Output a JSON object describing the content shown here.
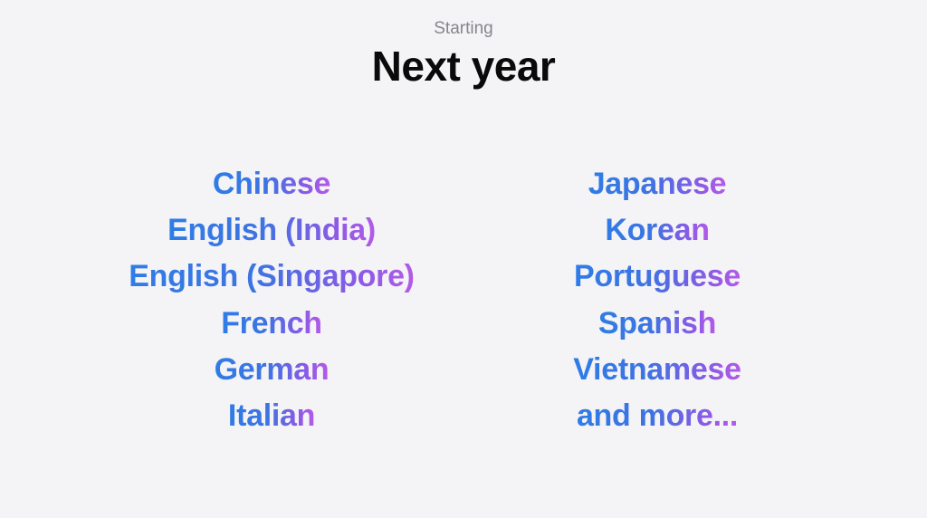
{
  "header": {
    "kicker": "Starting",
    "title": "Next year"
  },
  "languages": {
    "left": [
      "Chinese",
      "English (India)",
      "English (Singapore)",
      "French",
      "German",
      "Italian"
    ],
    "right": [
      "Japanese",
      "Korean",
      "Portuguese",
      "Spanish",
      "Vietnamese",
      "and more..."
    ]
  },
  "colors": {
    "gradient_start": "#2f7ce6",
    "gradient_end": "#b45ae8",
    "background": "#f4f3f6",
    "title": "#0a0a0a",
    "kicker": "#86868b"
  }
}
